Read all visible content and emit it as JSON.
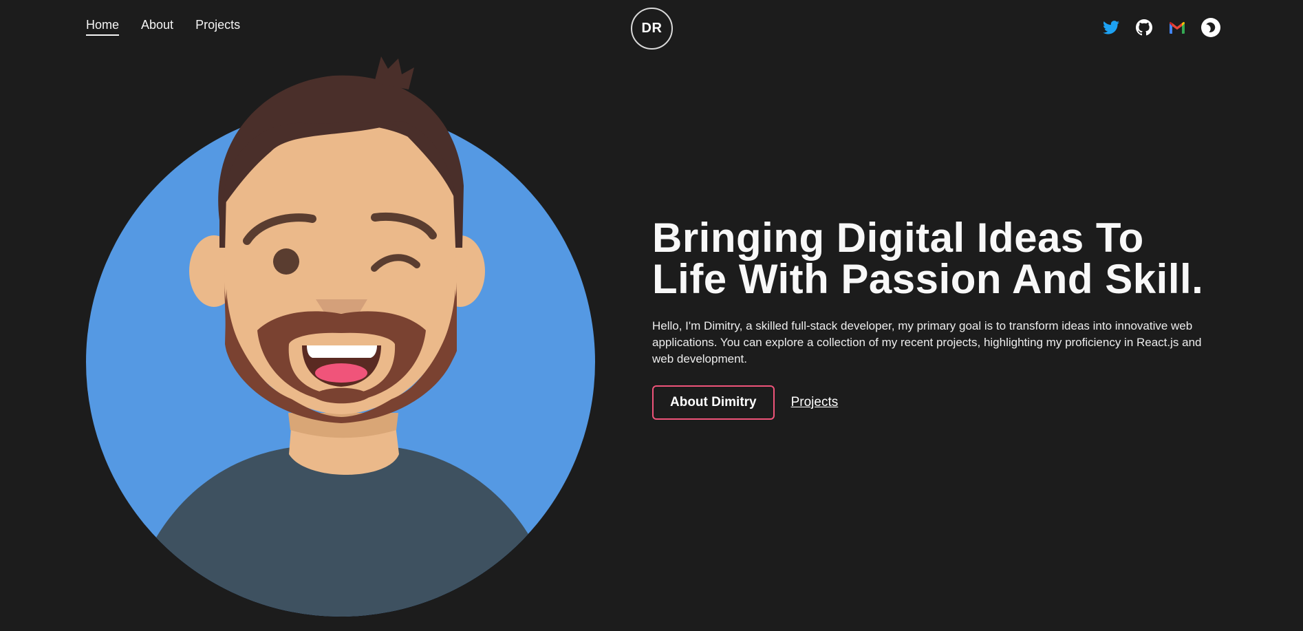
{
  "header": {
    "nav": [
      {
        "label": "Home",
        "active": true
      },
      {
        "label": "About",
        "active": false
      },
      {
        "label": "Projects",
        "active": false
      }
    ],
    "logo_text": "DR",
    "social_icons": [
      "twitter-icon",
      "github-icon",
      "gmail-icon",
      "moon-icon"
    ]
  },
  "hero": {
    "title": "Bringing Digital Ideas To Life With Passion And Skill.",
    "description": "Hello, I'm Dimitry, a skilled full-stack developer, my primary goal is to transform ideas into innovative web applications. You can explore a collection of my recent projects, highlighting my proficiency in React.js and web development.",
    "primary_button": "About Dimitry",
    "secondary_link": "Projects"
  },
  "colors": {
    "background": "#1c1c1c",
    "accent": "#f0547a",
    "avatar_circle": "#5599e3",
    "twitter": "#1da1f2"
  }
}
